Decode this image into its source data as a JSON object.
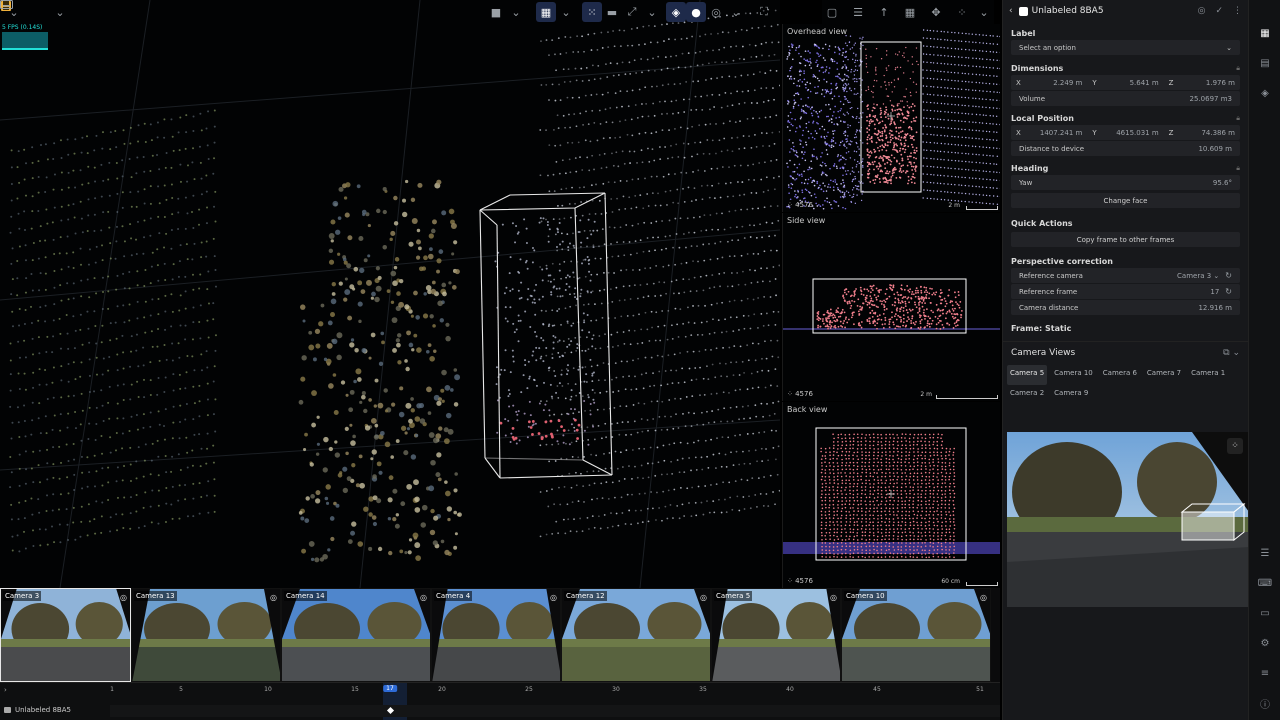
{
  "toolbar": {
    "fps_label": "5 FPS (0.14S)"
  },
  "overhead_view": {
    "title": "Overhead view",
    "point_count": "4576",
    "scale": "2 m"
  },
  "side_view": {
    "title": "Side view",
    "point_count": "4576",
    "scale": "2 m"
  },
  "back_view": {
    "title": "Back view",
    "point_count": "4576",
    "scale": "60 cm"
  },
  "panel": {
    "object_name": "Unlabeled 8BA5",
    "label_title": "Label",
    "label_placeholder": "Select an option",
    "dimensions_title": "Dimensions",
    "dim": {
      "x_key": "X",
      "x": "2.249 m",
      "y_key": "Y",
      "y": "5.641 m",
      "z_key": "Z",
      "z": "1.976 m"
    },
    "volume_label": "Volume",
    "volume_value": "25.0697 m3",
    "local_position_title": "Local Position",
    "pos": {
      "x_key": "X",
      "x": "1407.241 m",
      "y_key": "Y",
      "y": "4615.031 m",
      "z_key": "Z",
      "z": "74.386 m"
    },
    "distance_label": "Distance to device",
    "distance_value": "10.609 m",
    "heading_title": "Heading",
    "yaw_label": "Yaw",
    "yaw_value": "95.6°",
    "change_face": "Change face",
    "quick_actions_title": "Quick Actions",
    "copy_frame": "Copy frame to other frames",
    "perspective_title": "Perspective correction",
    "ref_camera_label": "Reference camera",
    "ref_camera_value": "Camera 3",
    "ref_frame_label": "Reference frame",
    "ref_frame_value": "17",
    "cam_distance_label": "Camera distance",
    "cam_distance_value": "12.916 m",
    "frame_static": "Frame: Static",
    "camera_views_title": "Camera Views",
    "camera_tabs": [
      "Camera 5",
      "Camera 10",
      "Camera 6",
      "Camera 7",
      "Camera 1",
      "Camera 2",
      "Camera 9"
    ]
  },
  "strip": {
    "cameras": [
      "Camera 3",
      "Camera 13",
      "Camera 14",
      "Camera 4",
      "Camera 12",
      "Camera 5",
      "Camera 10"
    ]
  },
  "timeline": {
    "ticks": [
      "1",
      "5",
      "10",
      "15",
      "20",
      "25",
      "30",
      "35",
      "40",
      "45",
      "51"
    ],
    "current_frame": "17",
    "track_name": "Unlabeled 8BA5"
  }
}
